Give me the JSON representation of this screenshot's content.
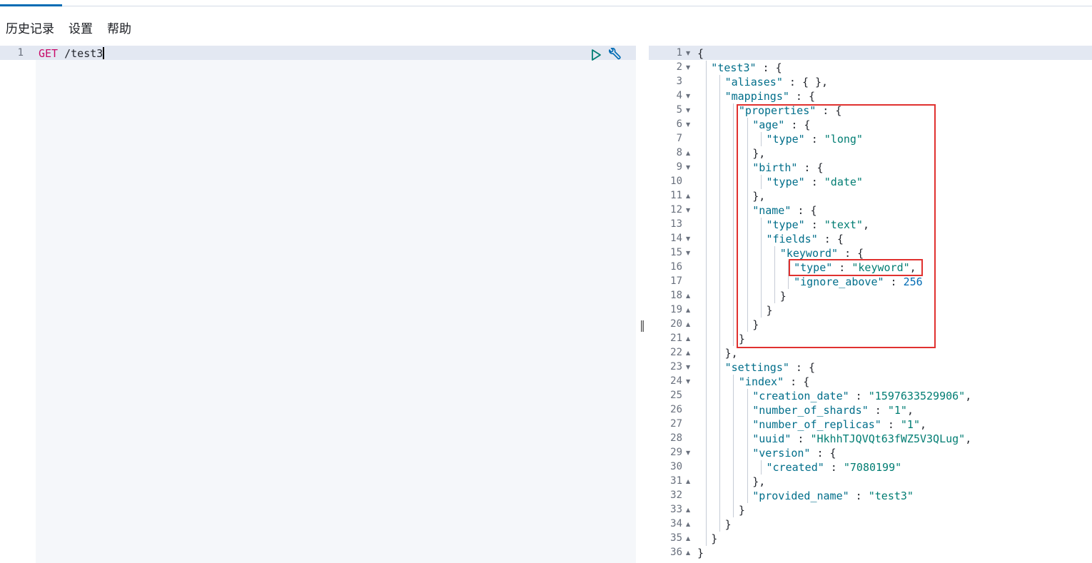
{
  "menu": {
    "history": "历史记录",
    "settings": "设置",
    "help": "帮助"
  },
  "request": {
    "line_number": "1",
    "method": "GET",
    "path": "/test3"
  },
  "response_lines": [
    {
      "n": "1",
      "f": "v",
      "indent": 0,
      "html": "{"
    },
    {
      "n": "2",
      "f": "v",
      "indent": 1,
      "html": "<span class='k'>\"test3\"</span> : {"
    },
    {
      "n": "3",
      "f": "",
      "indent": 2,
      "html": "<span class='k'>\"aliases\"</span> : { },"
    },
    {
      "n": "4",
      "f": "v",
      "indent": 2,
      "html": "<span class='k'>\"mappings\"</span> : {"
    },
    {
      "n": "5",
      "f": "v",
      "indent": 3,
      "html": "<span class='k'>\"properties\"</span> : {"
    },
    {
      "n": "6",
      "f": "v",
      "indent": 4,
      "html": "<span class='k'>\"age\"</span> : {"
    },
    {
      "n": "7",
      "f": "",
      "indent": 5,
      "html": "<span class='k'>\"type\"</span> : <span class='s'>\"long\"</span>"
    },
    {
      "n": "8",
      "f": "^",
      "indent": 4,
      "html": "},"
    },
    {
      "n": "9",
      "f": "v",
      "indent": 4,
      "html": "<span class='k'>\"birth\"</span> : {"
    },
    {
      "n": "10",
      "f": "",
      "indent": 5,
      "html": "<span class='k'>\"type\"</span> : <span class='s'>\"date\"</span>"
    },
    {
      "n": "11",
      "f": "^",
      "indent": 4,
      "html": "},"
    },
    {
      "n": "12",
      "f": "v",
      "indent": 4,
      "html": "<span class='k'>\"name\"</span> : {"
    },
    {
      "n": "13",
      "f": "",
      "indent": 5,
      "html": "<span class='k'>\"type\"</span> : <span class='s'>\"text\"</span>,"
    },
    {
      "n": "14",
      "f": "v",
      "indent": 5,
      "html": "<span class='k'>\"fields\"</span> : {"
    },
    {
      "n": "15",
      "f": "v",
      "indent": 6,
      "html": "<span class='k'>\"keyword\"</span> : {"
    },
    {
      "n": "16",
      "f": "",
      "indent": 7,
      "html": "<span class='k'>\"type\"</span> : <span class='s'>\"keyword\"</span>,"
    },
    {
      "n": "17",
      "f": "",
      "indent": 7,
      "html": "<span class='k'>\"ignore_above\"</span> : <span class='n'>256</span>"
    },
    {
      "n": "18",
      "f": "^",
      "indent": 6,
      "html": "}"
    },
    {
      "n": "19",
      "f": "^",
      "indent": 5,
      "html": "}"
    },
    {
      "n": "20",
      "f": "^",
      "indent": 4,
      "html": "}"
    },
    {
      "n": "21",
      "f": "^",
      "indent": 3,
      "html": "}"
    },
    {
      "n": "22",
      "f": "^",
      "indent": 2,
      "html": "},"
    },
    {
      "n": "23",
      "f": "v",
      "indent": 2,
      "html": "<span class='k'>\"settings\"</span> : {"
    },
    {
      "n": "24",
      "f": "v",
      "indent": 3,
      "html": "<span class='k'>\"index\"</span> : {"
    },
    {
      "n": "25",
      "f": "",
      "indent": 4,
      "html": "<span class='k'>\"creation_date\"</span> : <span class='s'>\"1597633529906\"</span>,"
    },
    {
      "n": "26",
      "f": "",
      "indent": 4,
      "html": "<span class='k'>\"number_of_shards\"</span> : <span class='s'>\"1\"</span>,"
    },
    {
      "n": "27",
      "f": "",
      "indent": 4,
      "html": "<span class='k'>\"number_of_replicas\"</span> : <span class='s'>\"1\"</span>,"
    },
    {
      "n": "28",
      "f": "",
      "indent": 4,
      "html": "<span class='k'>\"uuid\"</span> : <span class='s'>\"HkhhTJQVQt63fWZ5V3QLug\"</span>,"
    },
    {
      "n": "29",
      "f": "v",
      "indent": 4,
      "html": "<span class='k'>\"version\"</span> : {"
    },
    {
      "n": "30",
      "f": "",
      "indent": 5,
      "html": "<span class='k'>\"created\"</span> : <span class='s'>\"7080199\"</span>"
    },
    {
      "n": "31",
      "f": "^",
      "indent": 4,
      "html": "},"
    },
    {
      "n": "32",
      "f": "",
      "indent": 4,
      "html": "<span class='k'>\"provided_name\"</span> : <span class='s'>\"test3\"</span>"
    },
    {
      "n": "33",
      "f": "^",
      "indent": 3,
      "html": "}"
    },
    {
      "n": "34",
      "f": "^",
      "indent": 2,
      "html": "}"
    },
    {
      "n": "35",
      "f": "^",
      "indent": 1,
      "html": "}"
    },
    {
      "n": "36",
      "f": "^",
      "indent": 0,
      "html": "}"
    }
  ]
}
